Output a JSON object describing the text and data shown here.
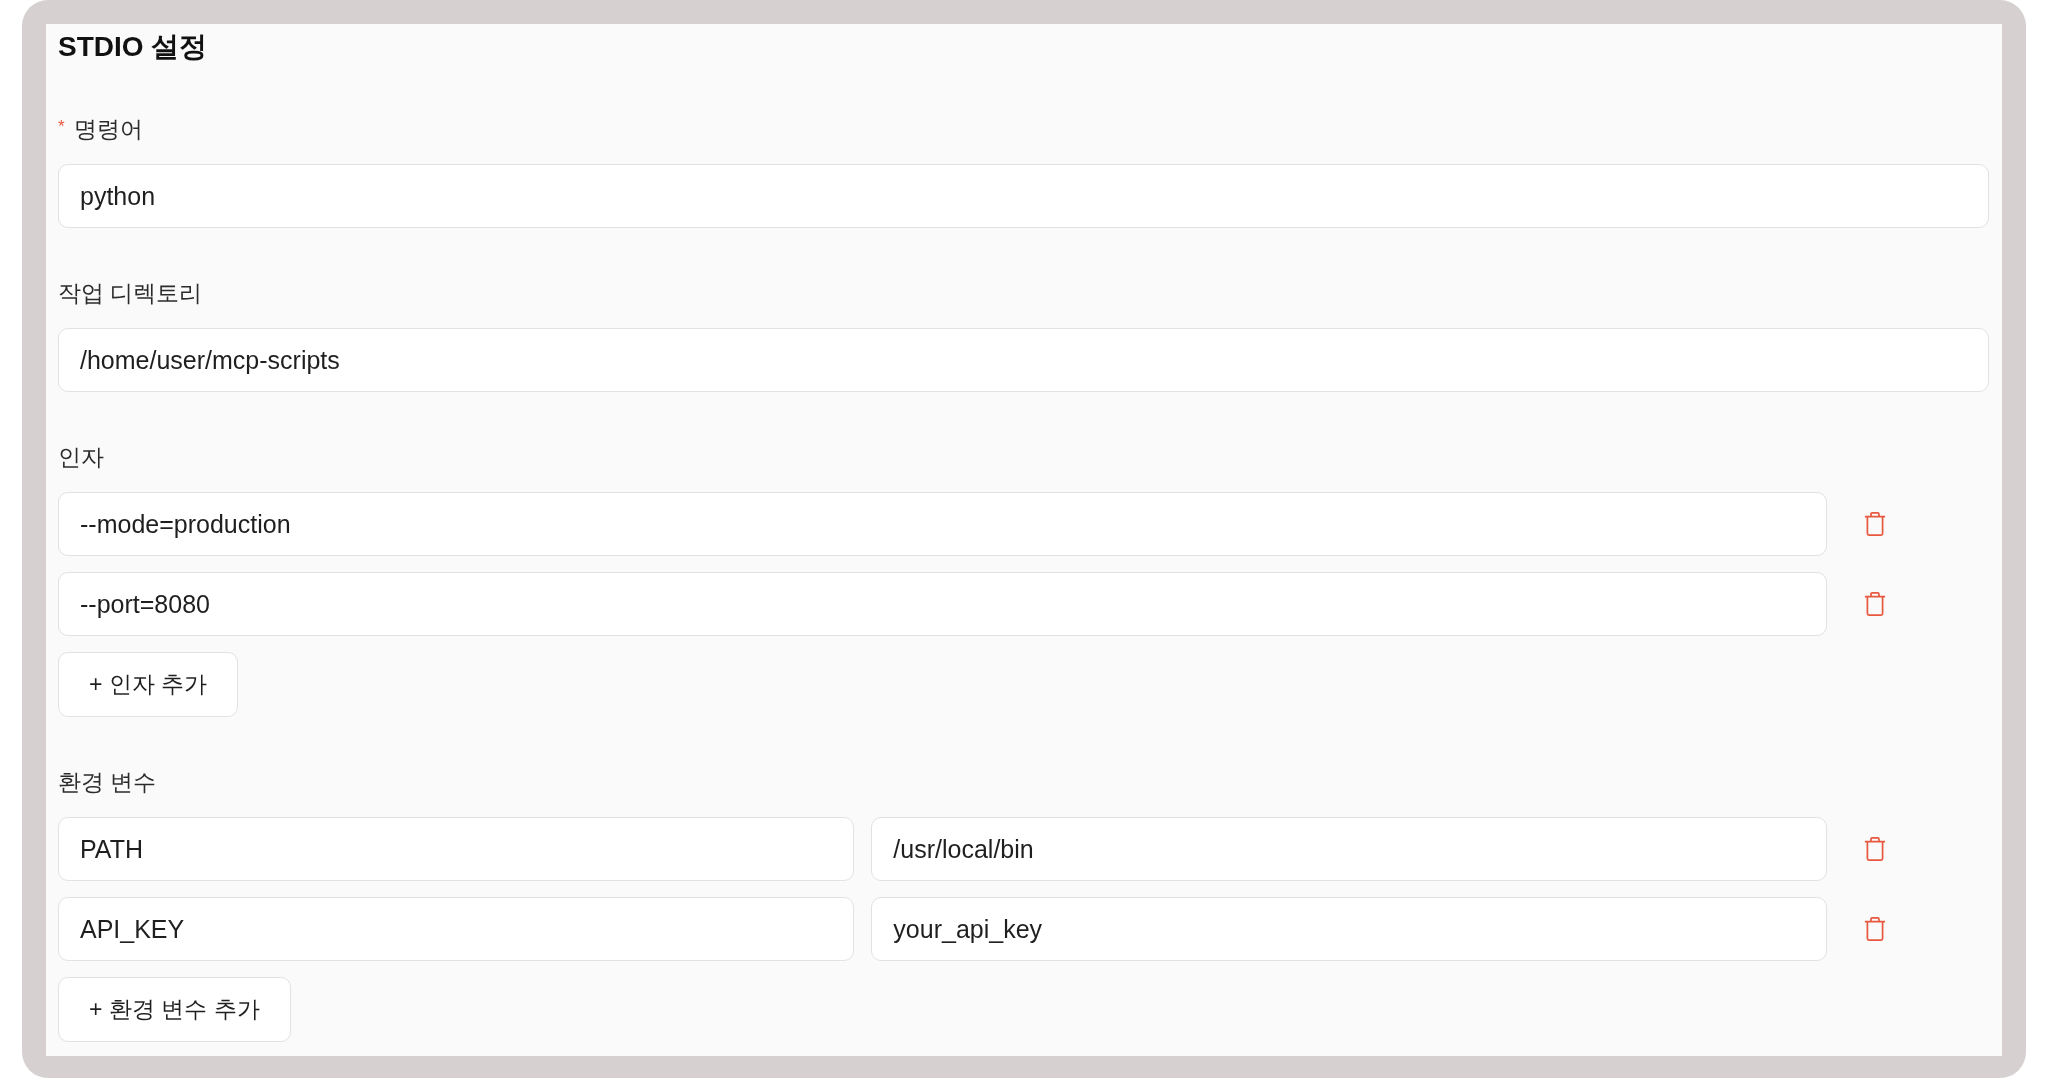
{
  "section": {
    "title": "STDIO 설정"
  },
  "required_mark": "*",
  "command": {
    "label": "명령어",
    "required": true,
    "value": "python"
  },
  "working_directory": {
    "label": "작업 디렉토리",
    "required": false,
    "value": "/home/user/mcp-scripts"
  },
  "arguments": {
    "label": "인자",
    "required": false,
    "items": [
      {
        "value": "--mode=production"
      },
      {
        "value": "--port=8080"
      }
    ],
    "add_button": "+ 인자 추가"
  },
  "environment": {
    "label": "환경 변수",
    "required": false,
    "items": [
      {
        "key": "PATH",
        "value": "/usr/local/bin"
      },
      {
        "key": "API_KEY",
        "value": "your_api_key"
      }
    ],
    "add_button": "+ 환경 변수 추가"
  }
}
